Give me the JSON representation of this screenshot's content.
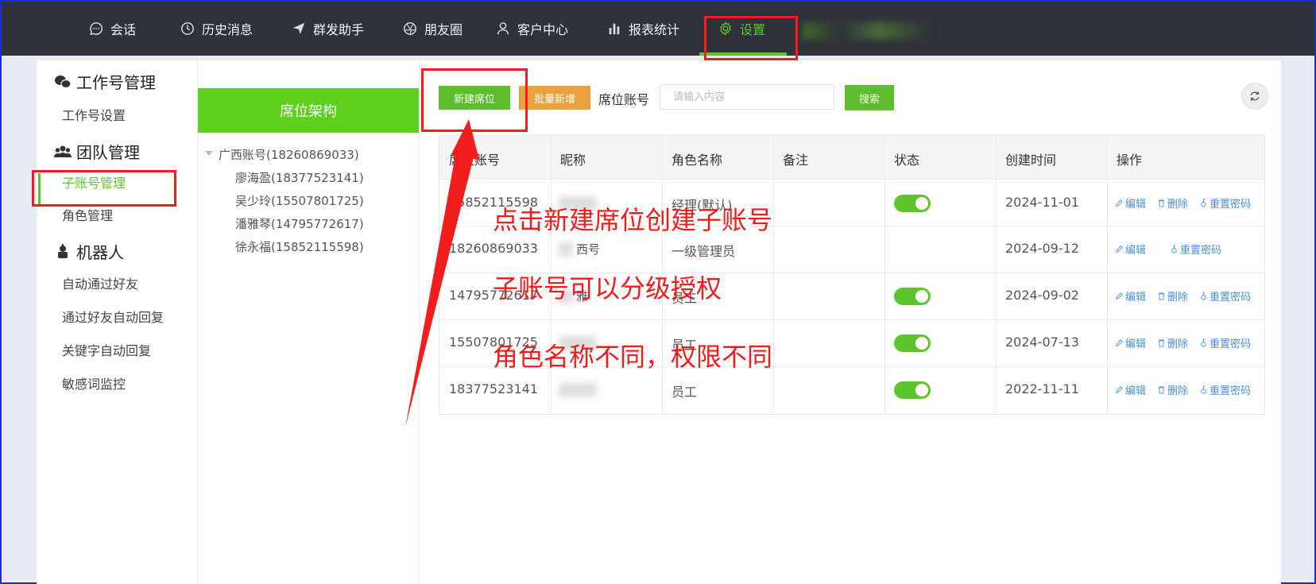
{
  "nav": {
    "items": [
      {
        "label": "会话",
        "icon": "chat-icon"
      },
      {
        "label": "历史消息",
        "icon": "clock-icon"
      },
      {
        "label": "群发助手",
        "icon": "send-icon"
      },
      {
        "label": "朋友圈",
        "icon": "aperture-icon"
      },
      {
        "label": "客户中心",
        "icon": "user-icon"
      },
      {
        "label": "报表统计",
        "icon": "bar-chart-icon"
      },
      {
        "label": "设置",
        "icon": "gear-icon",
        "active": true
      }
    ],
    "accent_color": "#5ec42b",
    "background": "#2f3238"
  },
  "sidebar": {
    "groups": [
      {
        "title": "工作号管理",
        "icon": "wechat-icon",
        "items": [
          "工作号设置"
        ]
      },
      {
        "title": "团队管理",
        "icon": "team-icon",
        "items": [
          "子账号管理",
          "角色管理"
        ]
      },
      {
        "title": "机器人",
        "icon": "robot-icon",
        "items": [
          "自动通过好友",
          "通过好友自动回复",
          "关键字自动回复",
          "敏感词监控"
        ]
      }
    ],
    "active_item": "子账号管理"
  },
  "tree": {
    "title": "席位架构",
    "root": "广西账号(18260869033)",
    "children": [
      "廖海盈(18377523141)",
      "吴少玲(15507801725)",
      "潘雅琴(14795772617)",
      "徐永福(15852115598)"
    ]
  },
  "toolbar": {
    "new_button": "新建席位",
    "batch_button": "批量新增",
    "account_label": "席位账号",
    "search_placeholder": "请输入内容",
    "search_button": "搜索"
  },
  "table": {
    "headers": [
      "席位账号",
      "昵称",
      "角色名称",
      "备注",
      "状态",
      "创建时间",
      "操作"
    ],
    "rows": [
      {
        "account": "15852115598",
        "role": "经理(默认)",
        "enabled": true,
        "created": "2024-11-01",
        "ops": [
          "编辑",
          "删除",
          "重置密码"
        ]
      },
      {
        "account": "18260869033",
        "nickname_partial": "西号",
        "role": "一级管理员",
        "enabled": null,
        "created": "2024-09-12",
        "ops": [
          "编辑",
          "重置密码"
        ]
      },
      {
        "account": "14795772617",
        "nickname_partial": "雅",
        "role": "员工",
        "enabled": true,
        "created": "2024-09-02",
        "ops": [
          "编辑",
          "删除",
          "重置密码"
        ]
      },
      {
        "account": "15507801725",
        "role": "员工",
        "enabled": true,
        "created": "2024-07-13",
        "ops": [
          "编辑",
          "删除",
          "重置密码"
        ]
      },
      {
        "account": "18377523141",
        "role": "员工",
        "enabled": true,
        "created": "2022-11-11",
        "ops": [
          "编辑",
          "删除",
          "重置密码"
        ]
      }
    ]
  },
  "annotations": {
    "line1": "点击新建席位创建子账号",
    "line2": "子账号可以分级授权",
    "line3": "角色名称不同，权限不同",
    "color": "#f41a1a"
  }
}
